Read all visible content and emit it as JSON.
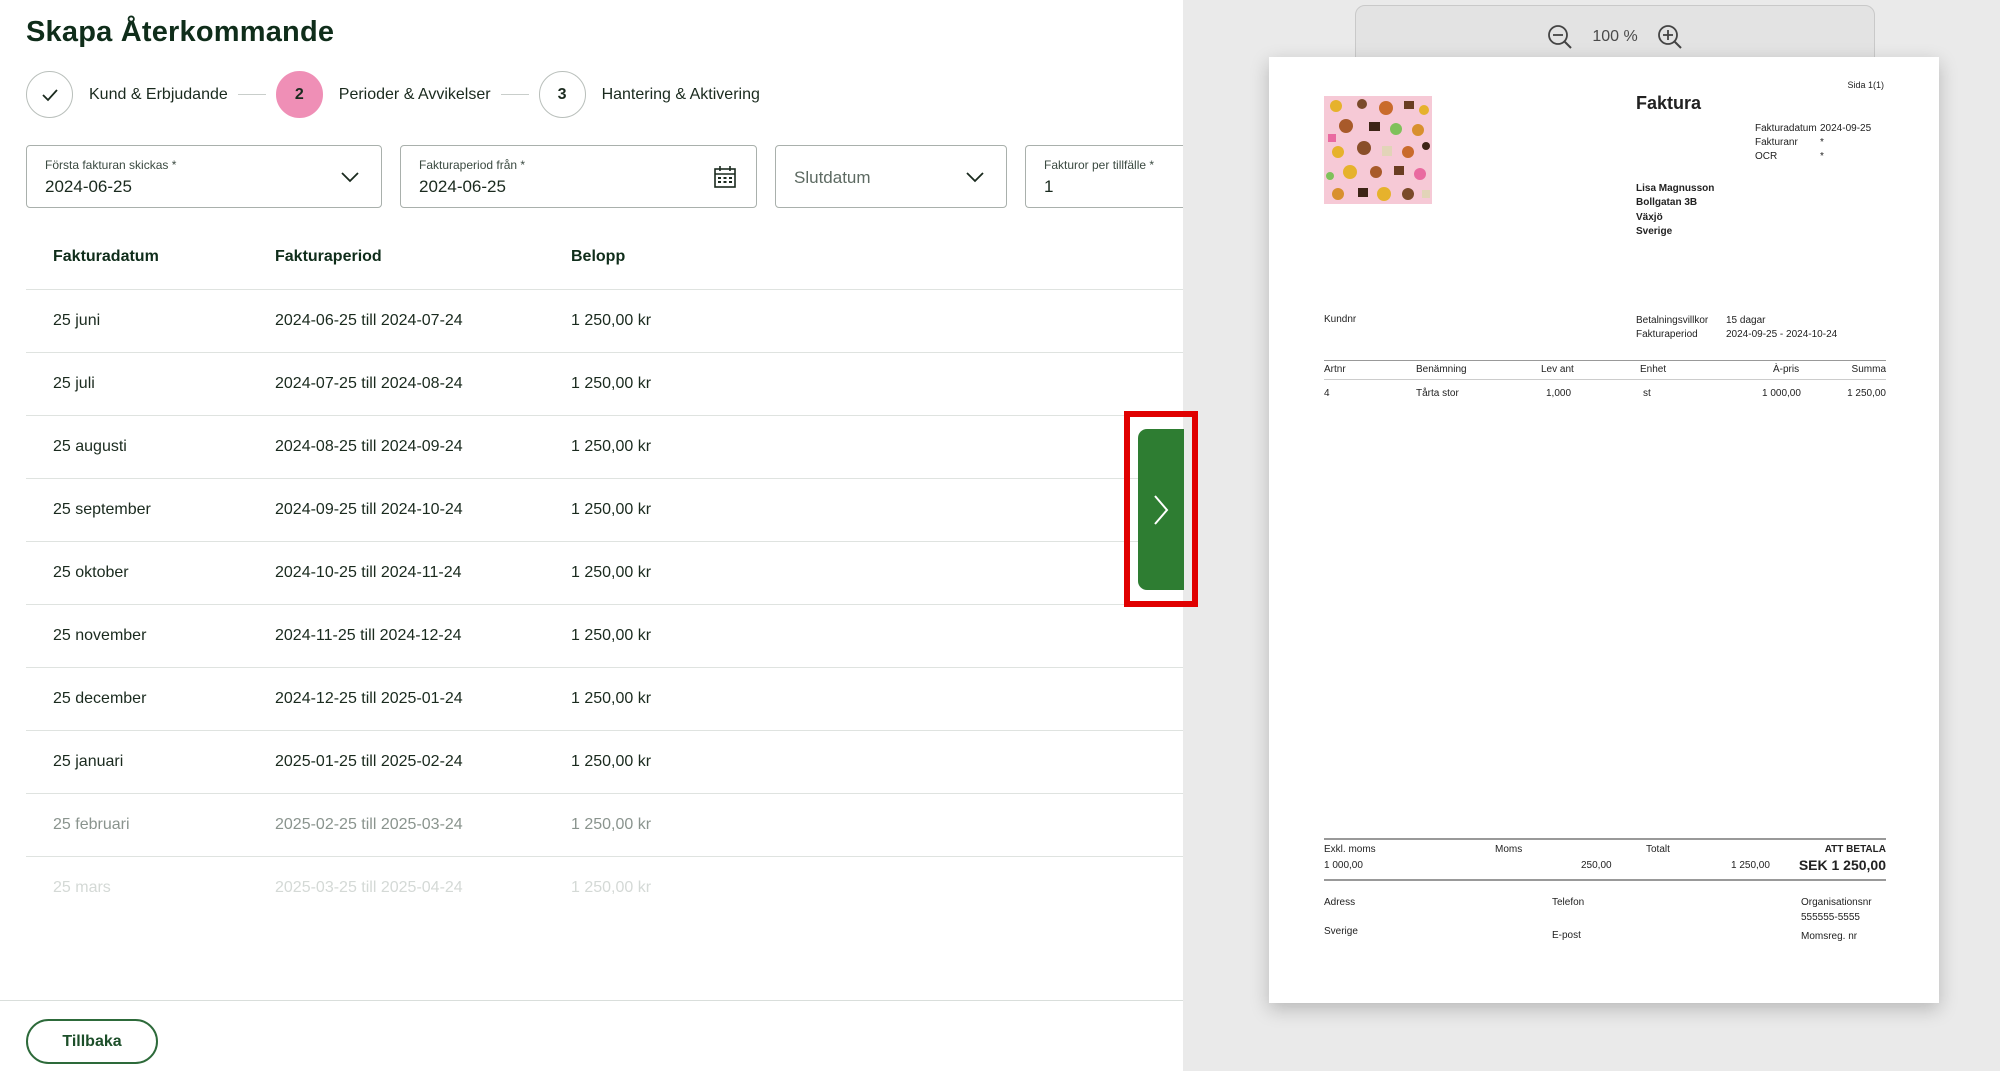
{
  "page": {
    "title": "Skapa Återkommande"
  },
  "stepper": {
    "steps": [
      {
        "number": "",
        "label": "Kund & Erbjudande",
        "state": "done"
      },
      {
        "number": "2",
        "label": "Perioder & Avvikelser",
        "state": "active"
      },
      {
        "number": "3",
        "label": "Hantering & Aktivering",
        "state": "pending"
      }
    ]
  },
  "fields": {
    "first_invoice": {
      "label": "Första fakturan skickas *",
      "value": "2024-06-25"
    },
    "period_from": {
      "label": "Fakturaperiod från *",
      "value": "2024-06-25"
    },
    "end_date": {
      "placeholder": "Slutdatum"
    },
    "invoices_per_occasion": {
      "label": "Fakturor per tillfälle *",
      "value": "1"
    }
  },
  "table": {
    "headers": [
      "Fakturadatum",
      "Fakturaperiod",
      "Belopp"
    ],
    "rows": [
      {
        "date": "25 juni",
        "period": "2024-06-25 till 2024-07-24",
        "amount": "1 250,00 kr"
      },
      {
        "date": "25 juli",
        "period": "2024-07-25 till 2024-08-24",
        "amount": "1 250,00 kr"
      },
      {
        "date": "25 augusti",
        "period": "2024-08-25 till 2024-09-24",
        "amount": "1 250,00 kr"
      },
      {
        "date": "25 september",
        "period": "2024-09-25 till 2024-10-24",
        "amount": "1 250,00 kr"
      },
      {
        "date": "25 oktober",
        "period": "2024-10-25 till 2024-11-24",
        "amount": "1 250,00 kr"
      },
      {
        "date": "25 november",
        "period": "2024-11-25 till 2024-12-24",
        "amount": "1 250,00 kr"
      },
      {
        "date": "25 december",
        "period": "2024-12-25 till 2025-01-24",
        "amount": "1 250,00 kr"
      },
      {
        "date": "25 januari",
        "period": "2025-01-25 till 2025-02-24",
        "amount": "1 250,00 kr"
      },
      {
        "date": "25 februari",
        "period": "2025-02-25 till 2025-03-24",
        "amount": "1 250,00 kr"
      },
      {
        "date": "25 mars",
        "period": "2025-03-25 till 2025-04-24",
        "amount": "1 250,00 kr"
      }
    ]
  },
  "footer": {
    "back_label": "Tillbaka"
  },
  "preview": {
    "zoom": "100 %",
    "invoice": {
      "page": "Sida 1(1)",
      "title": "Faktura",
      "meta_labels": [
        "Fakturadatum",
        "Fakturanr",
        "OCR"
      ],
      "meta_values": [
        "2024-09-25",
        "*",
        "*"
      ],
      "address": [
        "Lisa Magnusson",
        "Bollgatan 3B",
        "Växjö",
        "Sverige"
      ],
      "kundnr_label": "Kundnr",
      "terms_labels": [
        "Betalningsvillkor",
        "Fakturaperiod"
      ],
      "terms_values": [
        "15 dagar",
        "2024-09-25 - 2024-10-24"
      ],
      "line_headers": [
        "Artnr",
        "Benämning",
        "Lev ant",
        "Enhet",
        "À-pris",
        "Summa"
      ],
      "line_item": [
        "4",
        "Tårta stor",
        "1,000",
        "st",
        "1 000,00",
        "1 250,00"
      ],
      "totals_labels": [
        "Exkl. moms",
        "Moms",
        "Totalt",
        "ATT BETALA"
      ],
      "totals_values": [
        "1 000,00",
        "250,00",
        "1 250,00",
        "SEK 1 250,00"
      ],
      "footer_labels": [
        "Adress",
        "Telefon",
        "Organisationsnr"
      ],
      "footer_values": [
        "Sverige",
        "E-post",
        "555555-5555",
        "Momsreg. nr"
      ]
    }
  },
  "colors": {
    "accent_green": "#2e7d32",
    "active_step": "#ef8fb6",
    "highlight": "#e00000"
  }
}
